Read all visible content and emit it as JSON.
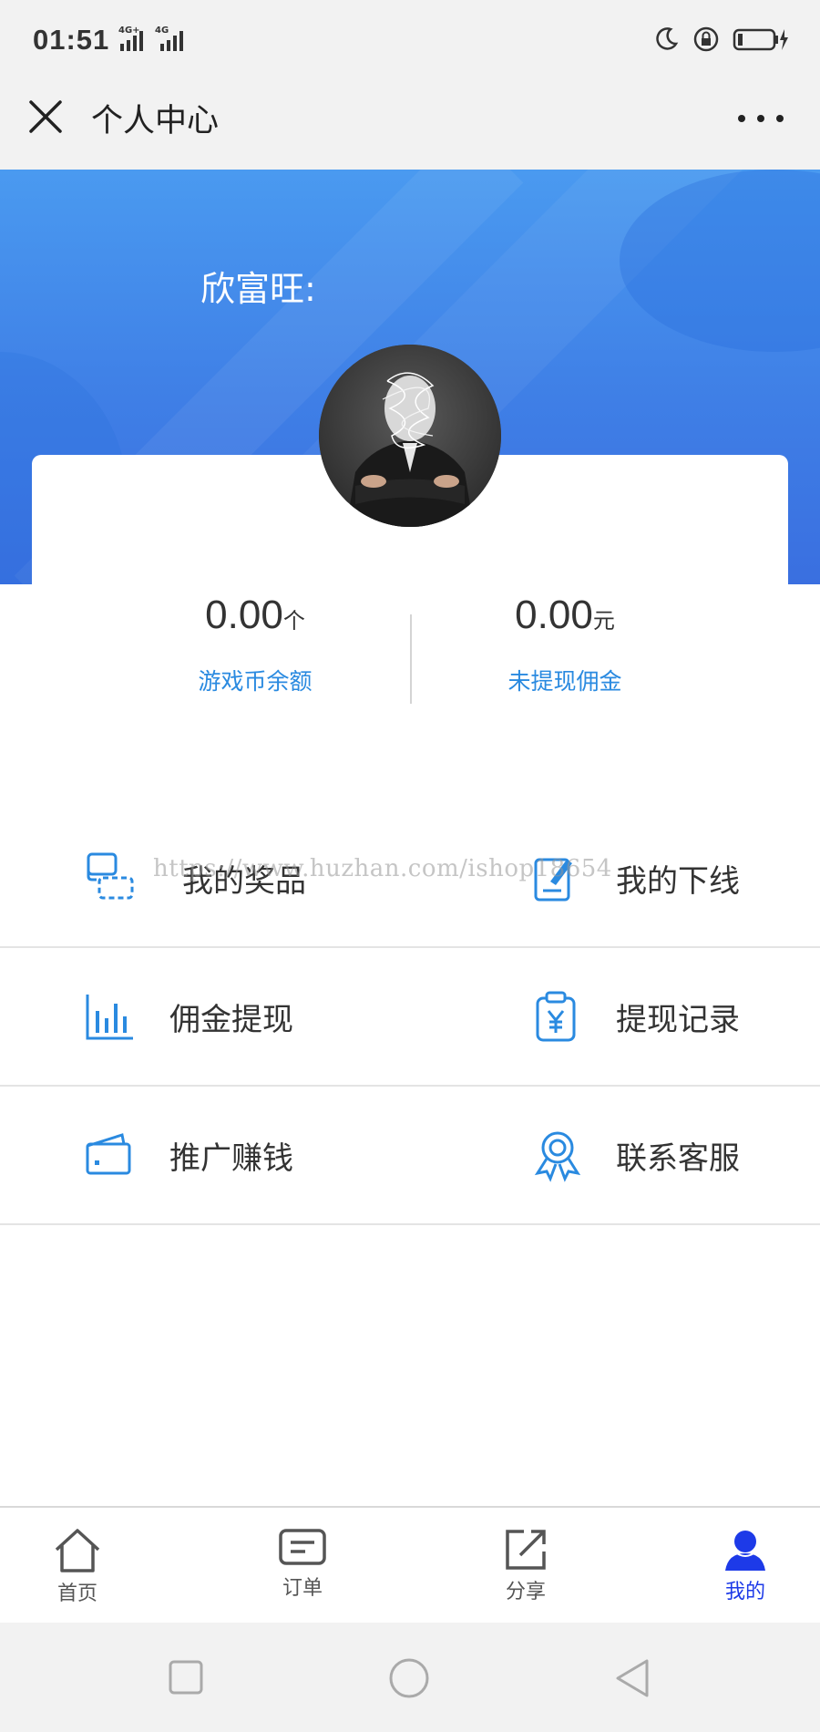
{
  "status_bar": {
    "time": "01:51",
    "network_1": "4G+",
    "network_2": "4G"
  },
  "title_bar": {
    "title": "个人中心"
  },
  "profile": {
    "username": "欣富旺:"
  },
  "stats": [
    {
      "value": "0.00",
      "unit": "个",
      "label": "游戏币余额"
    },
    {
      "value": "0.00",
      "unit": "元",
      "label": "未提现佣金"
    }
  ],
  "menu": {
    "my_prizes": "我的奖品",
    "my_downline": "我的下线",
    "withdraw": "佣金提现",
    "withdraw_records": "提现记录",
    "promote": "推广赚钱",
    "contact_service": "联系客服"
  },
  "watermark": "https://www.huzhan.com/ishop18654",
  "tabbar": {
    "home": "首页",
    "orders": "订单",
    "share": "分享",
    "mine": "我的"
  },
  "colors": {
    "accent": "#2a8ae0",
    "active_tab": "#1d3ae8",
    "header_blue": "#3f7fe6"
  }
}
